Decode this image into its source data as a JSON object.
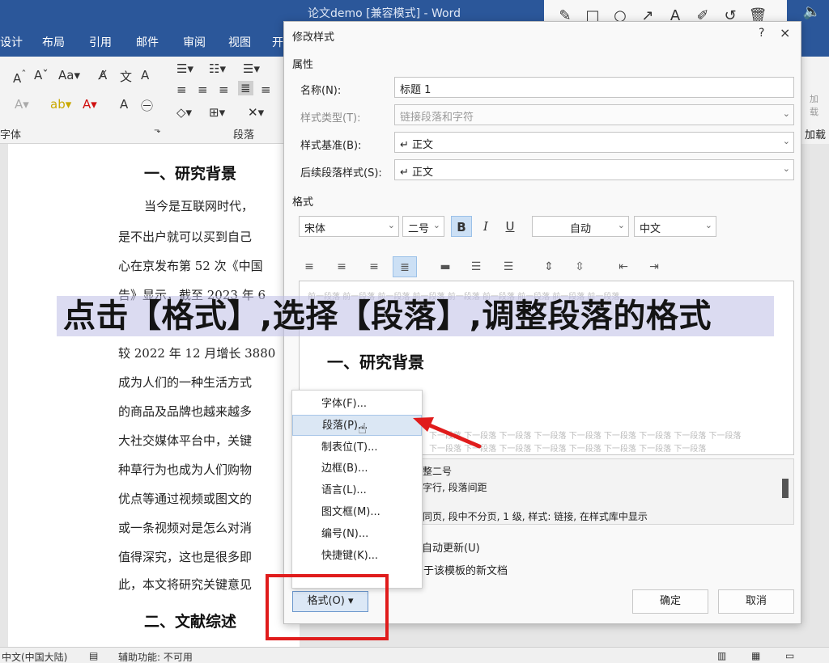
{
  "window": {
    "title": "论文demo [兼容模式] - Word"
  },
  "ribbon": {
    "tabs": [
      "设计",
      "布局",
      "引用",
      "邮件",
      "审阅",
      "视图",
      "开"
    ],
    "groups": [
      "字体",
      "段落",
      "加载"
    ],
    "right_labels": [
      "加",
      "载"
    ]
  },
  "annotation_toolbar": {
    "icons": [
      "pen-icon",
      "rectangle-icon",
      "circle-icon",
      "arrow-icon",
      "text-icon",
      "marker-icon",
      "undo-icon",
      "delete-icon"
    ],
    "speaker": "speaker-icon"
  },
  "document": {
    "heading1": "一、研究背景",
    "lines": [
      "当今是互联网时代，",
      "是不出户就可以买到自己",
      "心在京发布第 52 次《中国",
      "告》显示，截至 2023 年 6",
      "",
      "较 2022 年 12 月增长 3880",
      "成为人们的一种生活方式",
      "的商品及品牌也越来越多",
      "大社交媒体平台中，关键",
      "种草行为也成为人们购物",
      "优点等通过视频或图文的",
      "或一条视频对是怎么对消",
      "值得深究，这也是很多即",
      "此，本文将研究关键意见"
    ],
    "heading2": "二、文献综述"
  },
  "statusbar": {
    "language": "中文(中国大陆)",
    "accessibility": "辅助功能: 不可用"
  },
  "dialog": {
    "title": "修改样式",
    "help": "?",
    "close": "×",
    "properties_label": "属性",
    "name_label": "名称(N):",
    "name_value": "标题 1",
    "type_label": "样式类型(T):",
    "type_value": "链接段落和字符",
    "based_label": "样式基准(B):",
    "based_value": "↵ 正文",
    "next_label": "后续段落样式(S):",
    "next_value": "↵ 正文",
    "format_label": "格式",
    "font": "宋体",
    "size": "二号",
    "bold": "B",
    "italic": "I",
    "underline": "U",
    "color": "自动",
    "script": "中文",
    "preview_heading": "一、研究背景",
    "preview_ghost_top": "前一段落 前一段落 前一段落 前一段落 前一段落 前一段落 前一段落 前一段落 前一段落",
    "preview_ghost_bottom1": "下一段落 下一段落 下一段落 下一段落 下一段落 下一段落 下一段落 下一段落 下一段落",
    "preview_ghost_bottom2": "下一段落 下一段落 下一段落 下一段落 下一段落 下一段落 下一段落 下一段落",
    "desc_line1": "整二号",
    "desc_line2": "字行, 段落间距",
    "desc_line3": "同页, 段中不分页, 1 级, 样式: 链接, 在样式库中显示",
    "auto_update": "自动更新(U)",
    "template": "于该模板的新文档",
    "ok": "确定",
    "cancel": "取消",
    "format_button": "格式(O) ▾"
  },
  "format_menu": {
    "items": [
      "字体(F)...",
      "段落(P)...",
      "制表位(T)...",
      "边框(B)...",
      "语言(L)...",
      "图文框(M)...",
      "编号(N)...",
      "快捷键(K)..."
    ],
    "highlighted_index": 1
  },
  "caption": "点击【格式】,选择【段落】,调整段落的格式",
  "colors": {
    "word_blue": "#2b579a",
    "annotation_red": "#e01c1c",
    "menu_hover": "#dbe7f4"
  }
}
